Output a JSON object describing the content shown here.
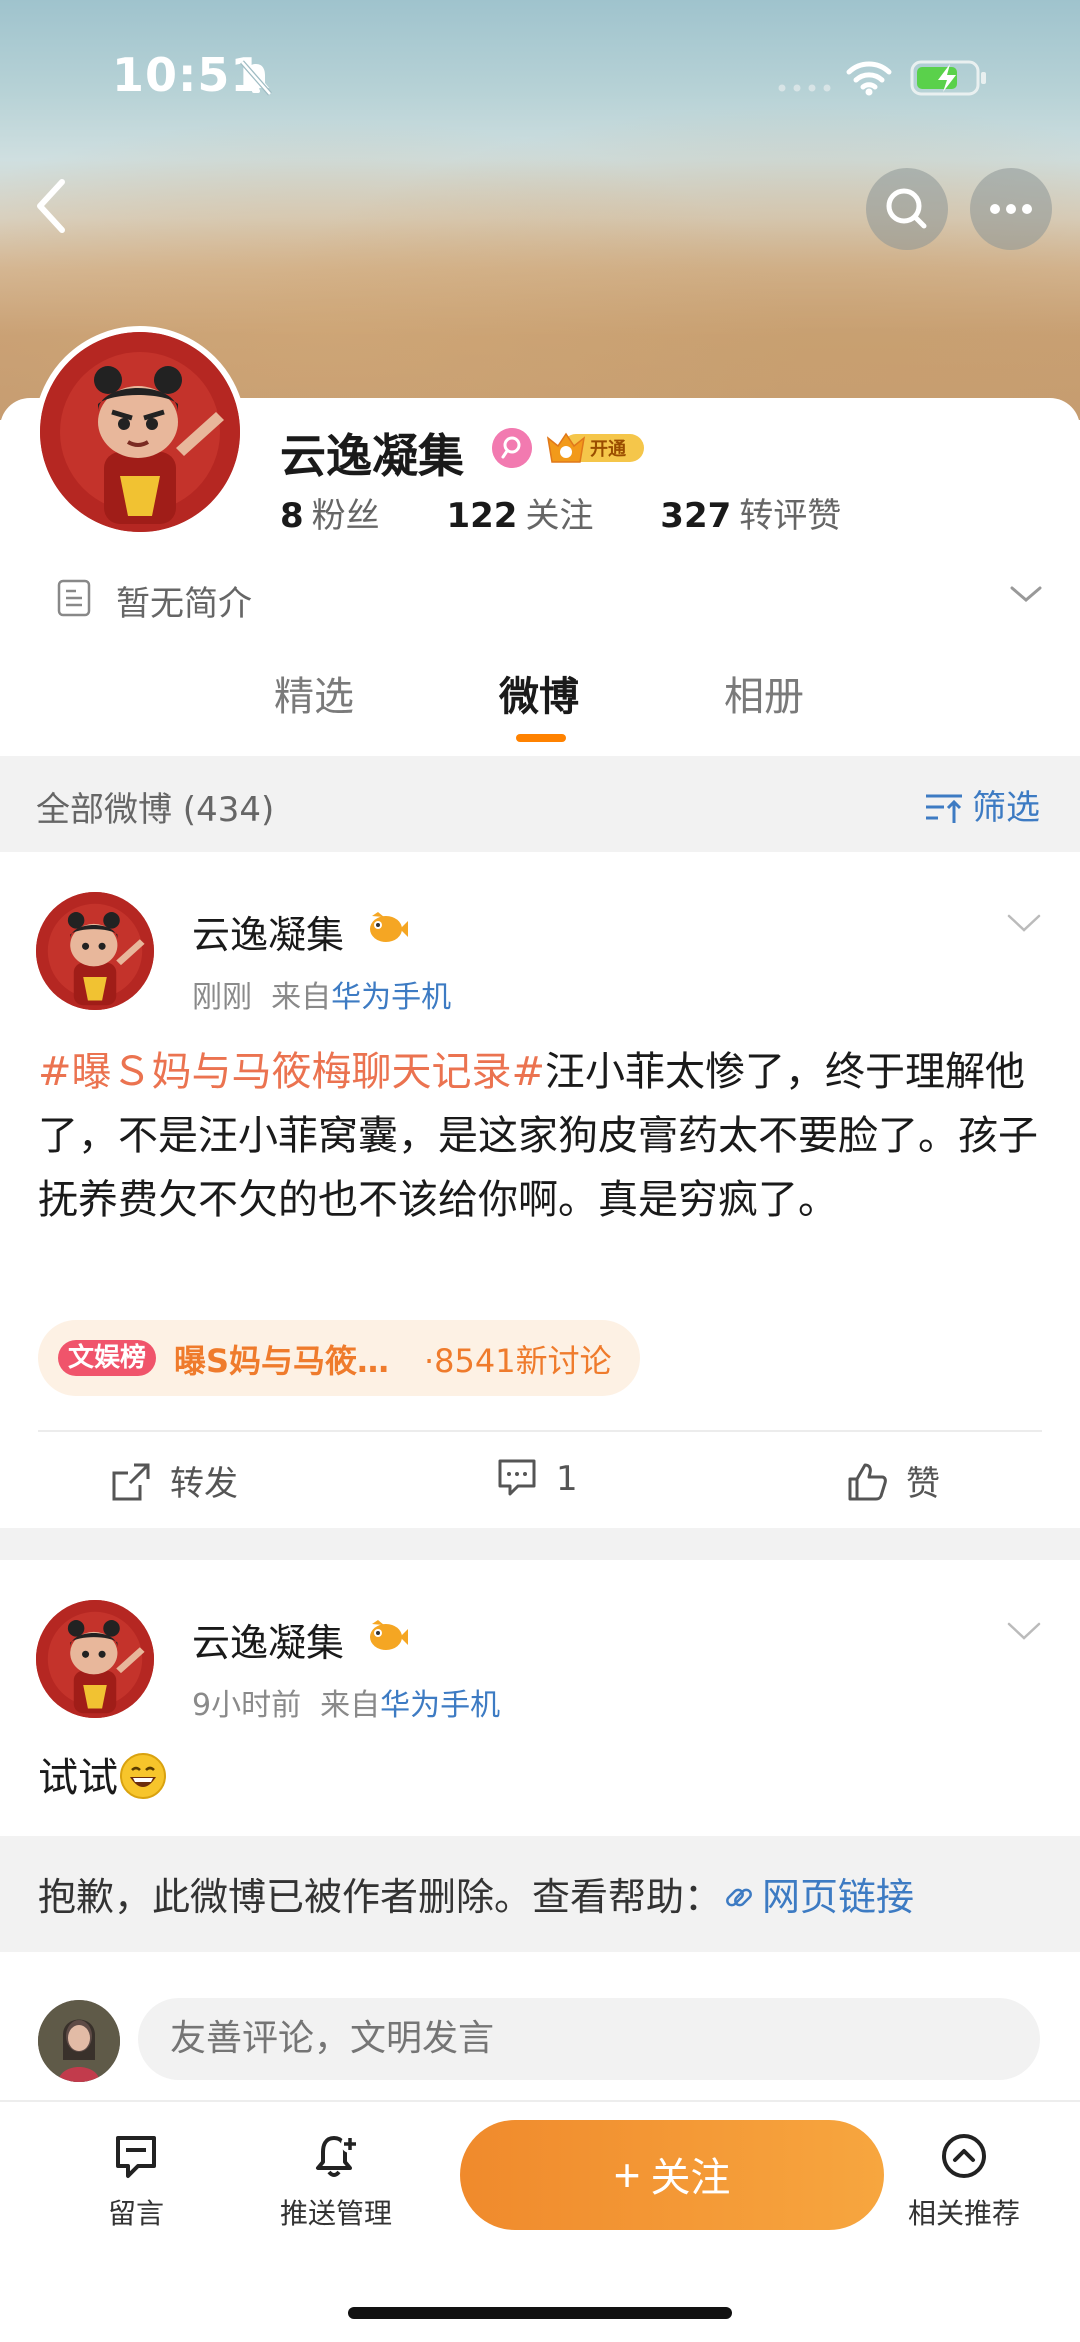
{
  "status_bar": {
    "time": "10:51"
  },
  "profile": {
    "name": "云逸凝集",
    "vip_label": "开通",
    "stats": [
      {
        "num": "8",
        "label": "粉丝"
      },
      {
        "num": "122",
        "label": "关注"
      },
      {
        "num": "327",
        "label": "转评赞"
      }
    ],
    "bio": "暂无简介"
  },
  "tabs": [
    "精选",
    "微博",
    "相册"
  ],
  "active_tab": "微博",
  "filter": {
    "count_label": "全部微博 (434)",
    "button_label": "筛选"
  },
  "posts": [
    {
      "author": "云逸凝集",
      "time": "刚刚",
      "source_prefix": "来自",
      "source": "华为手机",
      "hashtag": "#曝Ｓ妈与马筱梅聊天记录#",
      "text": "汪小菲太惨了，终于理解他了，不是汪小菲窝囊，是这家狗皮膏药太不要脸了。孩子抚养费欠不欠的也不该给你啊。真是穷疯了。",
      "topic": {
        "tag": "文娱榜",
        "name": "曝S妈与马筱…",
        "count": "·8541新讨论"
      },
      "actions": {
        "repost": "转发",
        "comment": "1",
        "like": "赞"
      }
    },
    {
      "author": "云逸凝集",
      "time": "9小时前",
      "source_prefix": "来自",
      "source": "华为手机",
      "text": "试试",
      "deleted_notice": "抱歉，此微博已被作者删除。查看帮助：",
      "deleted_link": "网页链接",
      "comment_placeholder": "友善评论，文明发言"
    }
  ],
  "bottom_bar": {
    "message": "留言",
    "push": "推送管理",
    "follow": "关注",
    "recommend": "相关推荐"
  },
  "colors": {
    "accent": "#ff8200",
    "link": "#3d7bc3",
    "hashtag": "#eb7350",
    "follow_button": "#f08a2c"
  }
}
